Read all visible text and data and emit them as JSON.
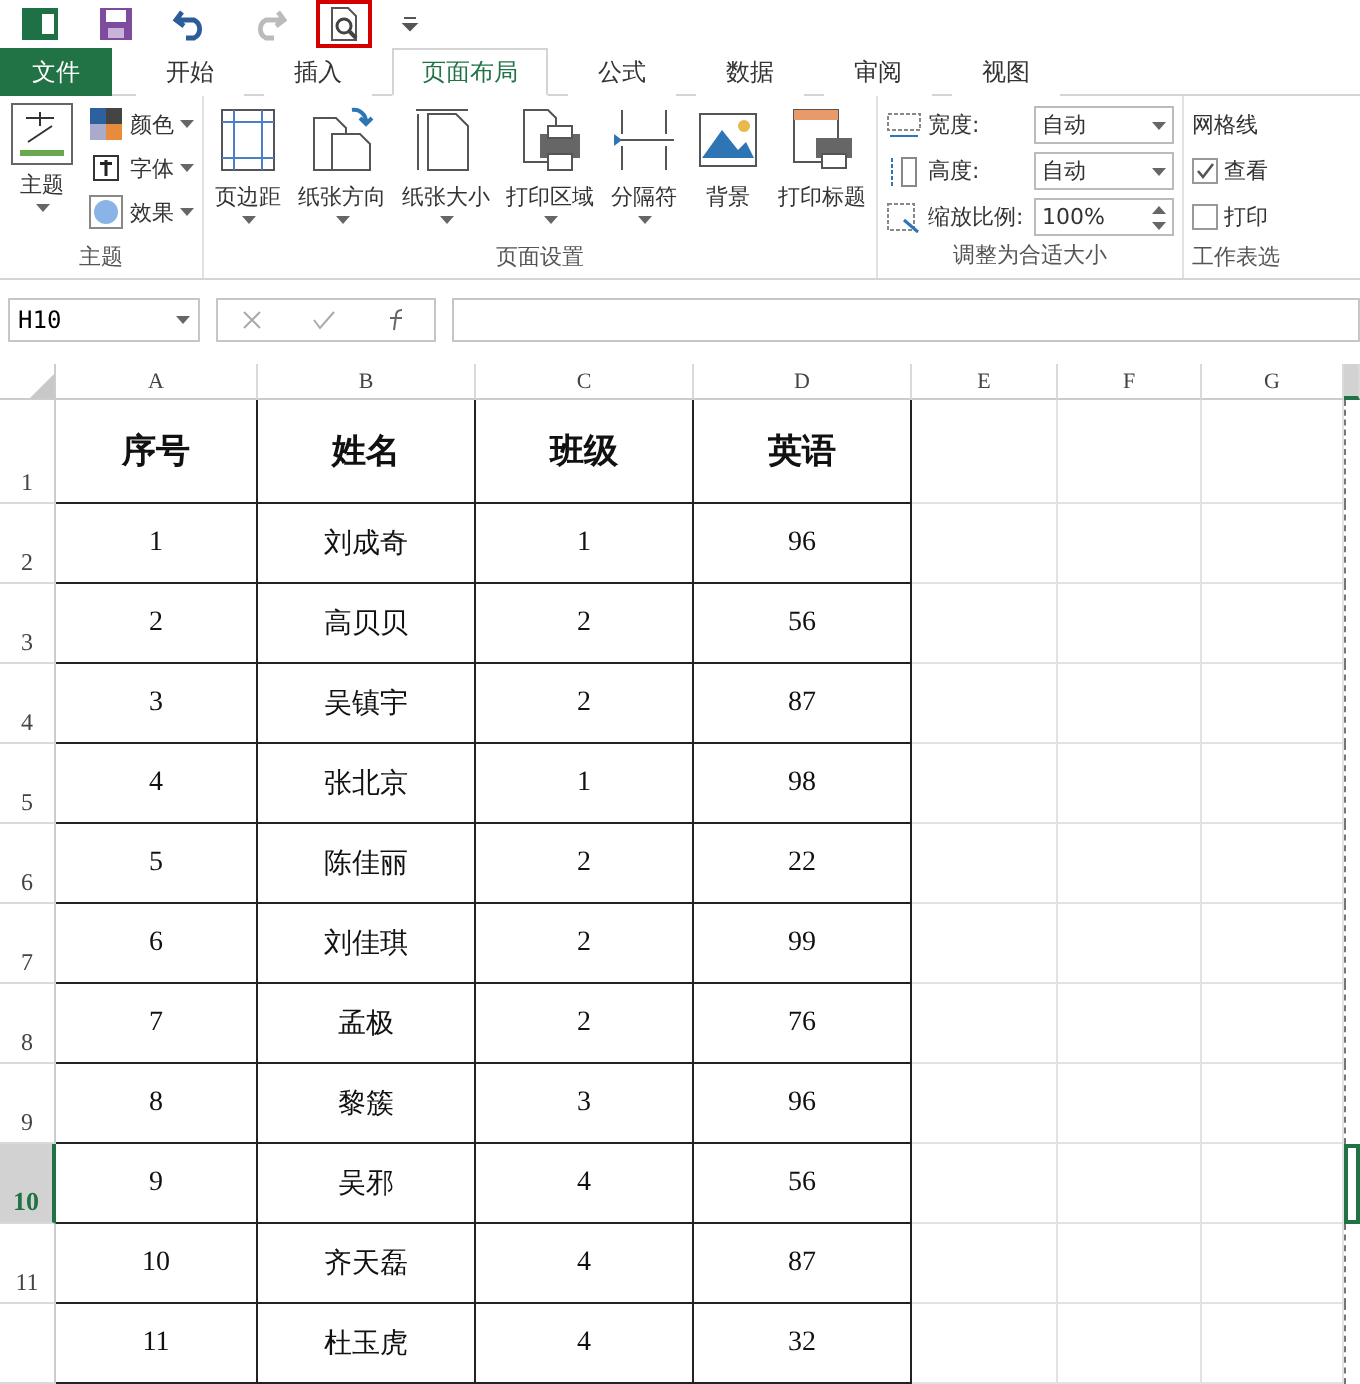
{
  "quick_access": [
    {
      "kind": "excel",
      "highlighted": false
    },
    {
      "kind": "save",
      "highlighted": false
    },
    {
      "kind": "undo",
      "highlighted": false
    },
    {
      "kind": "redo",
      "highlighted": false
    },
    {
      "kind": "preview",
      "highlighted": true
    },
    {
      "kind": "customize",
      "highlighted": false
    }
  ],
  "tabs": [
    {
      "label": "文件",
      "kind": "file",
      "selected": false
    },
    {
      "label": "开始",
      "kind": "tab",
      "selected": false
    },
    {
      "label": "插入",
      "kind": "tab",
      "selected": false
    },
    {
      "label": "页面布局",
      "kind": "tab",
      "selected": true
    },
    {
      "label": "公式",
      "kind": "tab",
      "selected": false
    },
    {
      "label": "数据",
      "kind": "tab",
      "selected": false
    },
    {
      "label": "审阅",
      "kind": "tab",
      "selected": false
    },
    {
      "label": "视图",
      "kind": "tab",
      "selected": false
    }
  ],
  "ribbon": {
    "theme_group": {
      "label": "主题",
      "big_button": "主题",
      "items": [
        {
          "label": "颜色",
          "kind": "colors"
        },
        {
          "label": "字体",
          "kind": "fonts"
        },
        {
          "label": "效果",
          "kind": "effects"
        }
      ]
    },
    "page_setup": {
      "label": "页面设置",
      "buttons": [
        {
          "label": "页边距",
          "kind": "margins",
          "dropdown": true
        },
        {
          "label": "纸张方向",
          "kind": "orientation",
          "dropdown": true
        },
        {
          "label": "纸张大小",
          "kind": "size",
          "dropdown": true
        },
        {
          "label": "打印区域",
          "kind": "print_area",
          "dropdown": true
        },
        {
          "label": "分隔符",
          "kind": "breaks",
          "dropdown": true
        },
        {
          "label": "背景",
          "kind": "background",
          "dropdown": false
        },
        {
          "label": "打印标题",
          "kind": "titles",
          "dropdown": false
        }
      ]
    },
    "scale": {
      "label": "调整为合适大小",
      "fields": [
        {
          "label": "宽度:",
          "value": "自动",
          "kind": "dropdown"
        },
        {
          "label": "高度:",
          "value": "自动",
          "kind": "dropdown"
        },
        {
          "label": "缩放比例:",
          "value": "100%",
          "kind": "spinner"
        }
      ]
    },
    "sheet_options": {
      "label": "工作表选",
      "heading": "网格线",
      "options": [
        {
          "label": "查看",
          "checked": true
        },
        {
          "label": "打印",
          "checked": false
        }
      ]
    }
  },
  "name_box": "H10",
  "columns": [
    {
      "label": "A",
      "selected": false
    },
    {
      "label": "B",
      "selected": false
    },
    {
      "label": "C",
      "selected": false
    },
    {
      "label": "D",
      "selected": false
    },
    {
      "label": "E",
      "selected": false
    },
    {
      "label": "F",
      "selected": false
    },
    {
      "label": "G",
      "selected": false
    },
    {
      "selected": true
    }
  ],
  "rows": [
    {
      "number": "1",
      "selected": false,
      "cells": [
        "序号",
        "姓名",
        "班级",
        "英语"
      ]
    },
    {
      "number": "2",
      "selected": false,
      "cells": [
        "1",
        "刘成奇",
        "1",
        "96"
      ]
    },
    {
      "number": "3",
      "selected": false,
      "cells": [
        "2",
        "高贝贝",
        "2",
        "56"
      ]
    },
    {
      "number": "4",
      "selected": false,
      "cells": [
        "3",
        "吴镇宇",
        "2",
        "87"
      ]
    },
    {
      "number": "5",
      "selected": false,
      "cells": [
        "4",
        "张北京",
        "1",
        "98"
      ]
    },
    {
      "number": "6",
      "selected": false,
      "cells": [
        "5",
        "陈佳丽",
        "2",
        "22"
      ]
    },
    {
      "number": "7",
      "selected": false,
      "cells": [
        "6",
        "刘佳琪",
        "2",
        "99"
      ]
    },
    {
      "number": "8",
      "selected": false,
      "cells": [
        "7",
        "孟极",
        "2",
        "76"
      ]
    },
    {
      "number": "9",
      "selected": false,
      "cells": [
        "8",
        "黎簇",
        "3",
        "96"
      ]
    },
    {
      "number": "10",
      "selected": true,
      "cells": [
        "9",
        "吴邪",
        "4",
        "56"
      ]
    },
    {
      "number": "11",
      "selected": false,
      "cells": [
        "10",
        "齐天磊",
        "4",
        "87"
      ]
    },
    {
      "selected": false,
      "cells": [
        "11",
        "杜玉虎",
        "4",
        "32"
      ]
    }
  ]
}
